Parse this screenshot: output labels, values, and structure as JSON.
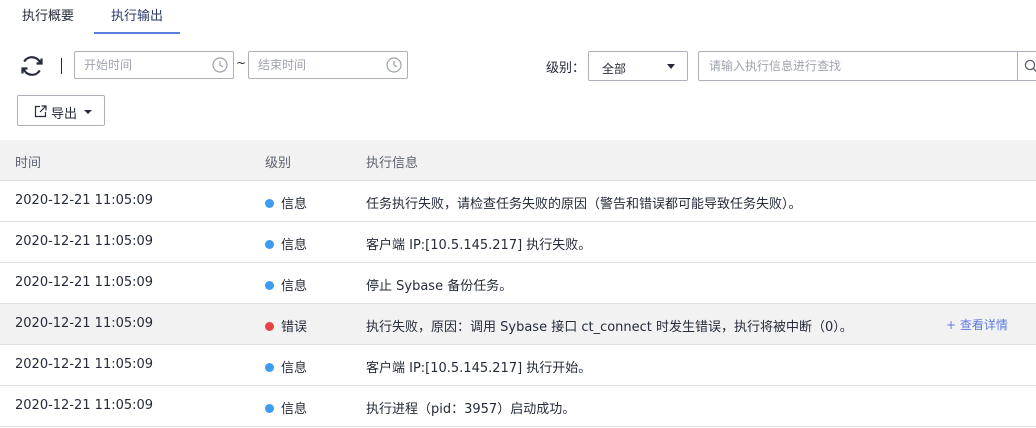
{
  "tabs": [
    {
      "label": "执行概要",
      "active": false
    },
    {
      "label": "执行输出",
      "active": true
    }
  ],
  "toolbar": {
    "start_placeholder": "开始时间",
    "range_separator": "~",
    "end_placeholder": "结束时间",
    "level_label": "级别：",
    "level_value": "全部",
    "search_placeholder": "请输入执行信息进行查找",
    "export_label": "导出"
  },
  "table": {
    "columns": [
      "时间",
      "级别",
      "执行信息"
    ],
    "rows": [
      {
        "time": "2020-12-21 11:05:09",
        "level": "信息",
        "message": "任务执行失败，请检查任务失败的原因（警告和错误都可能导致任务失败）。"
      },
      {
        "time": "2020-12-21 11:05:09",
        "level": "信息",
        "message": "客户端 IP:[10.5.145.217] 执行失败。"
      },
      {
        "time": "2020-12-21 11:05:09",
        "level": "信息",
        "message": "停止 Sybase 备份任务。"
      },
      {
        "time": "2020-12-21 11:05:09",
        "level": "错误",
        "message": "执行失败，原因：调用 Sybase 接口 ct_connect 时发生错误，执行将被中断（0）。",
        "link": "+ 查看详情"
      },
      {
        "time": "2020-12-21 11:05:09",
        "level": "信息",
        "message": "客户端 IP:[10.5.145.217] 执行开始。"
      },
      {
        "time": "2020-12-21 11:05:09",
        "level": "信息",
        "message": "执行进程（pid：3957）启动成功。"
      }
    ]
  },
  "colors": {
    "accent": "#5e7ce0",
    "info_dot": "#3c9cf0",
    "error_dot": "#e54545",
    "highlight_row": "#f2f2f3"
  },
  "icons": {
    "refresh": "refresh-icon",
    "clock": "clock-icon",
    "dropdown": "caret-down-icon",
    "search": "search-icon",
    "export": "export-icon"
  }
}
